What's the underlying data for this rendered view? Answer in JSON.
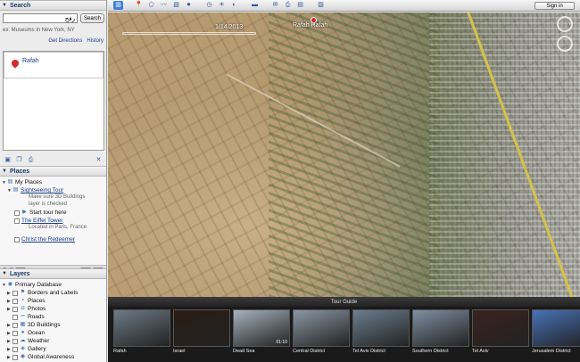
{
  "search": {
    "header": "Search",
    "input_value": "رفح",
    "button_label": "Search",
    "hint": "ex: Museums in New York, NY",
    "get_directions": "Get Directions",
    "history": "History",
    "result": "Rafah"
  },
  "places": {
    "header": "Places",
    "items": [
      {
        "label": "My Places"
      },
      {
        "label": "Sightseeing Tour"
      },
      {
        "label": "Make sure 3D Buildings"
      },
      {
        "label": "layer is checked"
      },
      {
        "label": "Start tour here"
      },
      {
        "label": "The Eiffel Tower"
      },
      {
        "label": "Located in Paris, France"
      },
      {
        "label": "Christ the Redeemer"
      }
    ]
  },
  "layers": {
    "header": "Layers",
    "items": [
      {
        "label": "Primary Database"
      },
      {
        "label": "Borders and Labels"
      },
      {
        "label": "Places"
      },
      {
        "label": "Photos"
      },
      {
        "label": "Roads"
      },
      {
        "label": "3D Buildings"
      },
      {
        "label": "Ocean"
      },
      {
        "label": "Weather"
      },
      {
        "label": "Gallery"
      },
      {
        "label": "Global Awareness"
      }
    ]
  },
  "topbar": {
    "signin_label": "Sign in"
  },
  "map": {
    "date": "1/14/2013",
    "label": "Rafah Rafah"
  },
  "tour": {
    "header": "Tour Guide",
    "cards": [
      {
        "name": "Rafah",
        "color": "#6d7a86"
      },
      {
        "name": "Israel",
        "color": "#2a1d14"
      },
      {
        "name": "Dead Sea",
        "color": "#a6b2bd",
        "duration": "01:10"
      },
      {
        "name": "Central District",
        "color": "#8b97a4"
      },
      {
        "name": "Tel Aviv District",
        "color": "#6a7f8e"
      },
      {
        "name": "Southern District",
        "color": "#7f8fa2"
      },
      {
        "name": "Tel Aviv",
        "color": "#3a2320"
      },
      {
        "name": "Jerusalem District",
        "color": "#4872b8"
      }
    ]
  }
}
